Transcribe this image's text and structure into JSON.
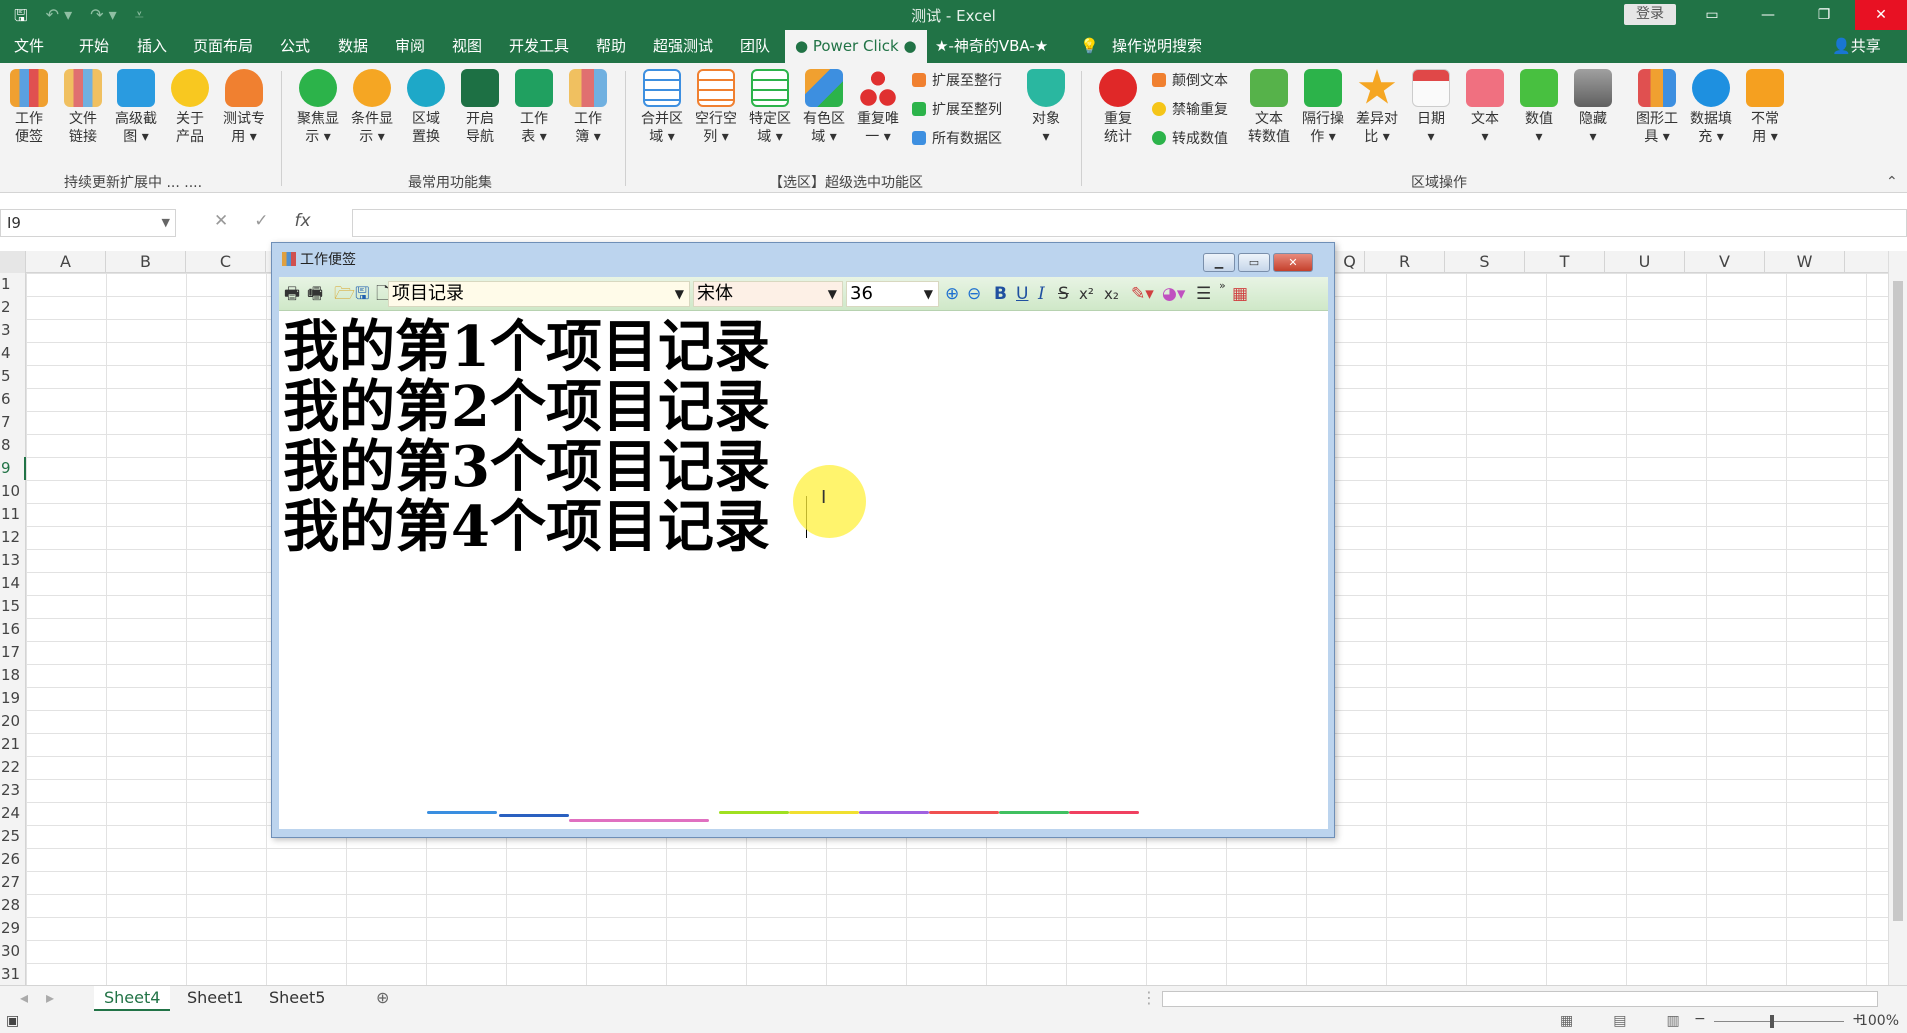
{
  "titlebar": {
    "title": "测试  -  Excel",
    "login": "登录",
    "save_icon": "save-icon",
    "undo_icon": "undo-icon",
    "redo_icon": "redo-icon",
    "customize_icon": "customize-qat-icon",
    "ribbon_display_icon": "ribbon-display-icon",
    "minimize_icon": "minimize-icon",
    "restore_icon": "restore-icon",
    "close_icon": "close-icon"
  },
  "tabs": [
    "文件",
    "开始",
    "插入",
    "页面布局",
    "公式",
    "数据",
    "审阅",
    "视图",
    "开发工具",
    "帮助",
    "超强测试",
    "团队",
    "● Power Click ●",
    "★-神奇的VBA-★",
    "操作说明搜索"
  ],
  "share": "共享",
  "ribbon": {
    "group1": {
      "label": "持续更新扩展中 ... ....",
      "buttons": [
        "工作\n便签",
        "文件\n链接",
        "高级截\n图 ▾",
        "关于\n产品",
        "测试专\n用 ▾"
      ]
    },
    "group2": {
      "label": "最常用功能集",
      "buttons": [
        "聚焦显\n示 ▾",
        "条件显\n示 ▾",
        "区域\n置换",
        "开启\n导航",
        "工作\n表 ▾",
        "工作\n簿 ▾"
      ]
    },
    "group3": {
      "label": "【选区】超级选中功能区",
      "buttons": [
        "合并区\n域 ▾",
        "空行空\n列 ▾",
        "特定区\n域 ▾",
        "有色区\n域 ▾",
        "重复唯\n一 ▾"
      ],
      "small": [
        "扩展至整行",
        "扩展至整列",
        "所有数据区"
      ],
      "object": "对象\n▾"
    },
    "group4": {
      "label": "区域操作",
      "first": "重复\n统计",
      "small": [
        "颠倒文本",
        "禁输重复",
        "转成数值"
      ],
      "buttons": [
        "文本\n转数值",
        "隔行操\n作 ▾",
        "差异对\n比 ▾",
        "日期\n▾",
        "文本\n▾",
        "数值\n▾",
        "隐藏\n▾",
        "图形工\n具 ▾",
        "数据填\n充 ▾",
        "不常\n用 ▾"
      ]
    }
  },
  "formula_bar": {
    "name_box": "I9",
    "cancel": "✕",
    "enter": "✓",
    "fx": "fx",
    "value": ""
  },
  "columns_left": [
    "A",
    "B",
    "C"
  ],
  "columns_right": [
    "Q",
    "R",
    "S",
    "T",
    "U",
    "V",
    "W"
  ],
  "rows": [
    "1",
    "2",
    "3",
    "4",
    "5",
    "6",
    "7",
    "8",
    "9",
    "10",
    "11",
    "12",
    "13",
    "14",
    "15",
    "16",
    "17",
    "18",
    "19",
    "20",
    "21",
    "22",
    "23",
    "24",
    "25",
    "26",
    "27",
    "28",
    "29",
    "30",
    "31"
  ],
  "selected_row": "9",
  "sheets": [
    "Sheet4",
    "Sheet1",
    "Sheet5"
  ],
  "active_sheet": "Sheet4",
  "status": {
    "zoom": "100%",
    "zoom_minus": "−",
    "zoom_plus": "+"
  },
  "note_window": {
    "title": "工作便签",
    "note_name": "项目记录",
    "font_name": "宋体",
    "font_size": "36",
    "format_buttons": {
      "bold": "B",
      "underline": "U",
      "italic": "I",
      "strike": "S",
      "sup": "x²",
      "sub": "x₂"
    },
    "lines": [
      "我的第1个项目记录",
      "我的第2个项目记录",
      "我的第3个项目记录",
      "我的第4个项目记录"
    ]
  },
  "colors": {
    "accent": "#217346",
    "close_red": "#e81123",
    "note_toolbar": "#d8ecd2",
    "highlight": "#fff03c"
  }
}
